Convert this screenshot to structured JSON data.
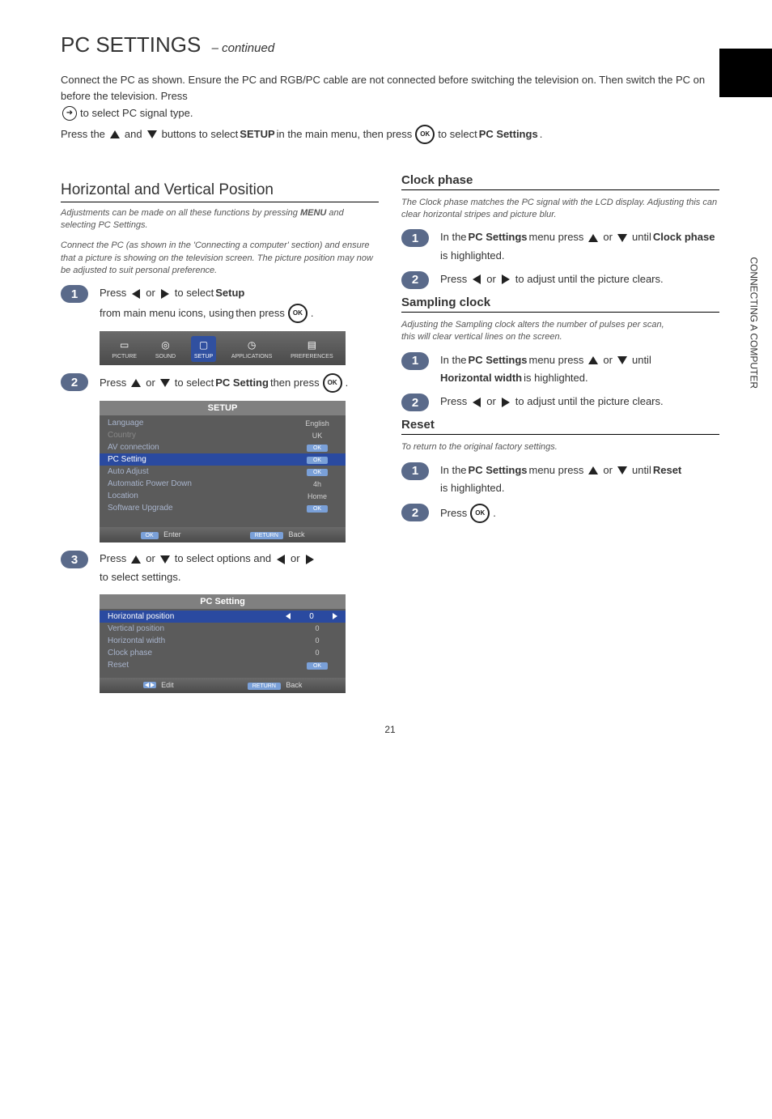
{
  "pageTitle": "PC SETTINGS",
  "pageTitleSub": "– continued",
  "sideText": "CONNECTING A COMPUTER",
  "intro": {
    "line1a": "Connect the PC as shown. Ensure the PC and RGB/PC cable are not connected before switching the television on. Then switch the PC on before the television. Press ",
    "line1b": " to select PC signal type.",
    "line2a": "Press the ",
    "line2b": " and ",
    "line2c": " buttons to select ",
    "line2d": "SETUP",
    "line2e": " in the main menu, then press ",
    "line2f": " to select ",
    "line2g": "PC Settings",
    "line2h": "."
  },
  "leftCol": {
    "section1": {
      "title": "Horizontal and Vertical Position",
      "notePrefix": "Adjustments can be made on all these functions by pressing ",
      "noteSuffix": " and selecting PC Settings.",
      "noteMid": "MENU"
    },
    "note2": "Connect the PC (as shown in the 'Connecting a computer' section) and ensure that a picture is showing on the television screen. The picture position may now be adjusted to suit personal preference.",
    "step1": {
      "pre": "Press ",
      "mid": " to select ",
      "bold": "Setup",
      "post1": " from main menu icons, using ",
      "or": " or ",
      "post2": " then press ",
      "end": "."
    },
    "step2": {
      "pre": "Press ",
      "or": " or ",
      "mid": " to select ",
      "bold": "PC Setting",
      "post": " then press ",
      "end": "."
    },
    "step3": {
      "pre": "Press ",
      "or": " or ",
      "mid": " to select options and ",
      "or2": " or ",
      "post": " to select settings."
    },
    "osdTabs": [
      {
        "label": "PICTURE",
        "glyph": "▭"
      },
      {
        "label": "SOUND",
        "glyph": "◎"
      },
      {
        "label": "SETUP",
        "glyph": "▢"
      },
      {
        "label": "APPLICATIONS",
        "glyph": "◷"
      },
      {
        "label": "PREFERENCES",
        "glyph": "▤"
      }
    ],
    "setupMenu": {
      "title": "SETUP",
      "rows": [
        {
          "label": "Language",
          "value": "English",
          "type": "text"
        },
        {
          "label": "Country",
          "value": "UK",
          "type": "text",
          "dim": true
        },
        {
          "label": "AV connection",
          "value": "OK",
          "type": "ok"
        },
        {
          "label": "PC Setting",
          "value": "OK",
          "type": "ok",
          "selected": true
        },
        {
          "label": "Auto Adjust",
          "value": "OK",
          "type": "ok"
        },
        {
          "label": "Automatic Power Down",
          "value": "4h",
          "type": "text"
        },
        {
          "label": "Location",
          "value": "Home",
          "type": "text"
        },
        {
          "label": "Software Upgrade",
          "value": "OK",
          "type": "ok"
        }
      ],
      "footer": {
        "okLabel": "OK",
        "okText": "Enter",
        "retLabel": "RETURN",
        "retText": "Back"
      }
    },
    "pcMenu": {
      "title": "PC Setting",
      "rows": [
        {
          "label": "Horizontal position",
          "value": "0",
          "selected": true,
          "slider": true
        },
        {
          "label": "Vertical position",
          "value": "0"
        },
        {
          "label": "Horizontal width",
          "value": "0"
        },
        {
          "label": "Clock phase",
          "value": "0"
        },
        {
          "label": "Reset",
          "value": "OK",
          "type": "ok"
        }
      ],
      "footer": {
        "editText": "Edit",
        "retLabel": "RETURN",
        "retText": "Back"
      }
    }
  },
  "rightCol": {
    "clockPhase": {
      "title": "Clock phase",
      "note": "The Clock phase matches the PC signal with the LCD display. Adjusting this can clear horizontal stripes and picture blur.",
      "step1": {
        "pre": "In the ",
        "bold": "PC Settings",
        "mid": " menu press ",
        "or": " or ",
        "post": " until ",
        "bold2": "Clock phase",
        "end": " is highlighted."
      },
      "step2": {
        "pre": "Press ",
        "or": " or ",
        "post": " to adjust until the picture clears."
      }
    },
    "samplingClock": {
      "title": "Sampling clock",
      "noteLine1": "Adjusting the Sampling clock alters the number of pulses per scan,",
      "noteLine2": "this will clear vertical lines on the screen.",
      "step1": {
        "pre": "In the ",
        "bold": "PC Settings",
        "mid": " menu press ",
        "or": " or ",
        "post": " until ",
        "bold2": "Horizontal width",
        "end": " is highlighted."
      },
      "step2": {
        "pre": "Press ",
        "or": " or ",
        "post": " to adjust until the picture clears."
      }
    },
    "reset": {
      "title": "Reset",
      "note": "To return to the original factory settings.",
      "step1": {
        "pre": "In the ",
        "bold": "PC Settings",
        "mid": " menu press ",
        "or": " or ",
        "post": " until ",
        "bold2": "Reset",
        "end": " is highlighted."
      },
      "step2": {
        "pre": "Press ",
        "end": "."
      }
    }
  },
  "pageNumber": "21",
  "okLabel": "OK"
}
